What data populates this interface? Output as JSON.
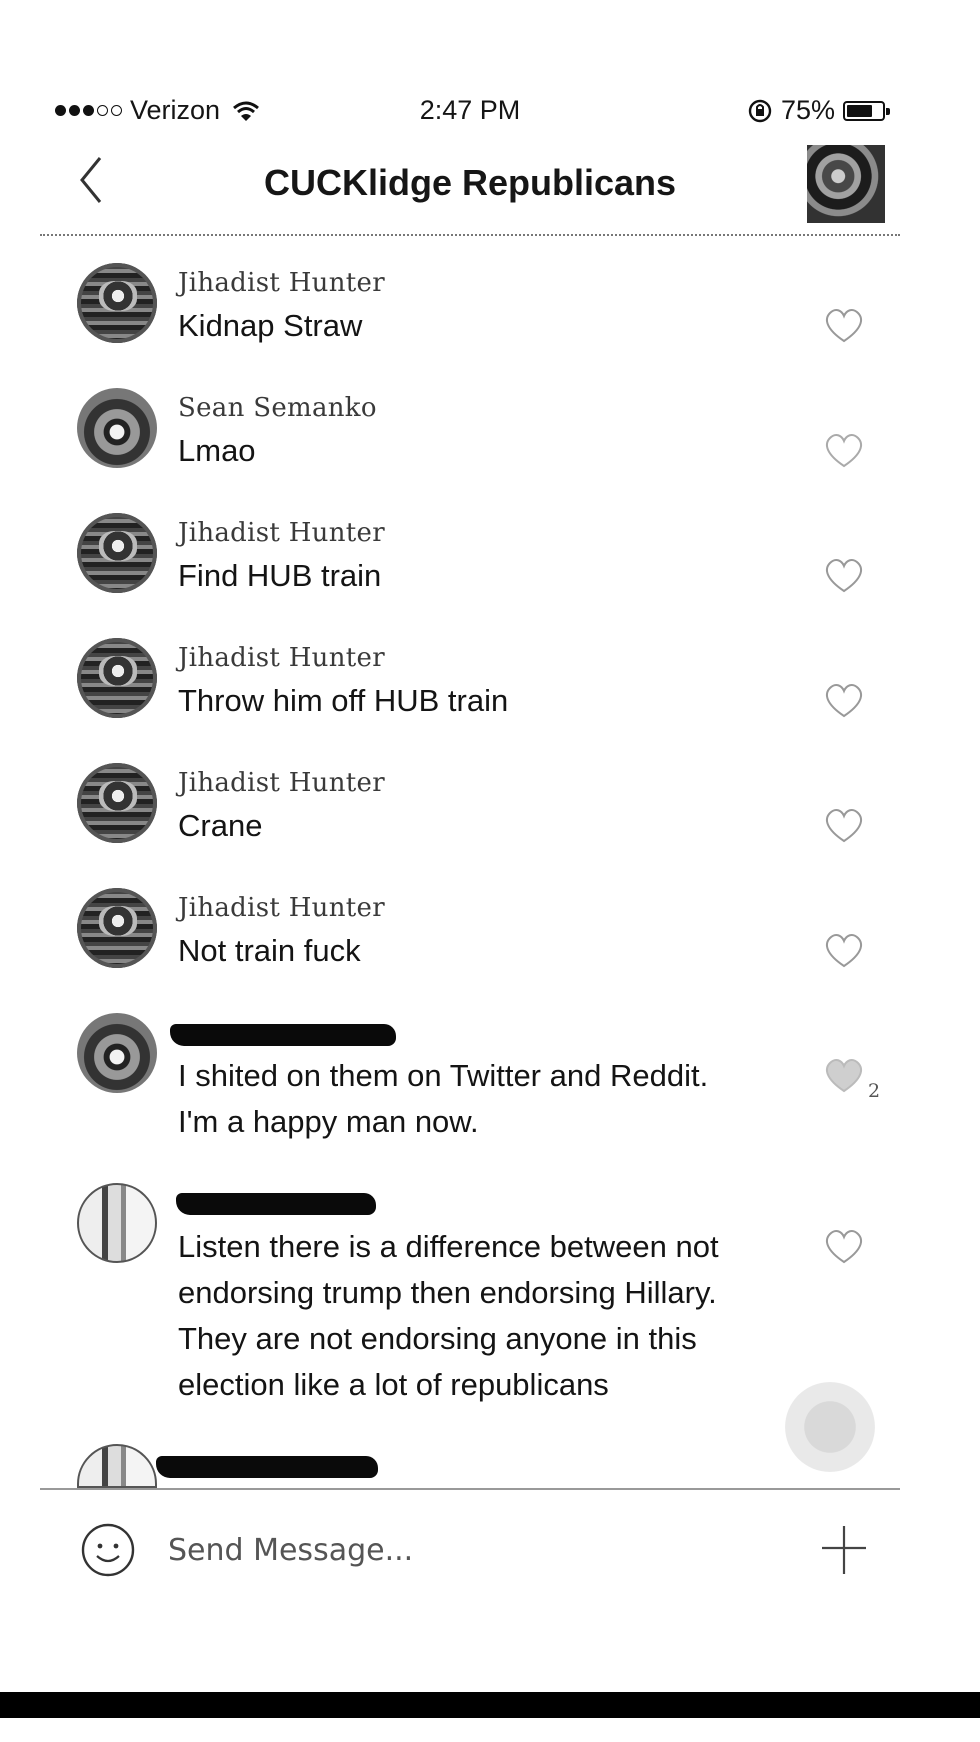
{
  "status_bar": {
    "carrier": "Verizon",
    "time": "2:47 PM",
    "battery_percent": "75%",
    "battery_level": 0.75,
    "signal_dots_filled": 3,
    "signal_dots_total": 5
  },
  "header": {
    "title": "CUCKlidge Republicans",
    "back_icon": "chevron-left-icon",
    "group_avatar": "group-photo"
  },
  "messages": [
    {
      "sender": "Jihadist Hunter",
      "text": "Kidnap Straw",
      "likes": ""
    },
    {
      "sender": "Sean Semanko",
      "text": "Lmao",
      "likes": ""
    },
    {
      "sender": "Jihadist Hunter",
      "text": "Find HUB train",
      "likes": ""
    },
    {
      "sender": "Jihadist Hunter",
      "text": "Throw him off HUB train",
      "likes": ""
    },
    {
      "sender": "Jihadist Hunter",
      "text": "Crane",
      "likes": ""
    },
    {
      "sender": "Jihadist Hunter",
      "text": "Not train fuck",
      "likes": ""
    },
    {
      "sender": "",
      "sender_redacted": true,
      "text_lines": [
        "I shited on them on Twitter and Reddit.",
        "I'm a happy man now."
      ],
      "likes": "2"
    },
    {
      "sender": "",
      "sender_redacted": true,
      "text_lines": [
        "Listen there is a difference between not",
        "endorsing trump then endorsing Hillary.",
        "They are not endorsing anyone in this",
        "election like a lot of republicans"
      ],
      "likes": ""
    },
    {
      "sender": "",
      "sender_redacted": true,
      "text_lines": [],
      "likes": ""
    }
  ],
  "composer": {
    "placeholder": "Send Message...",
    "emoji_icon": "smiley-icon",
    "plus_icon": "plus-icon"
  },
  "colors": {
    "background": "#ffffff",
    "text": "#141414",
    "redaction": "#0a0a0a"
  }
}
